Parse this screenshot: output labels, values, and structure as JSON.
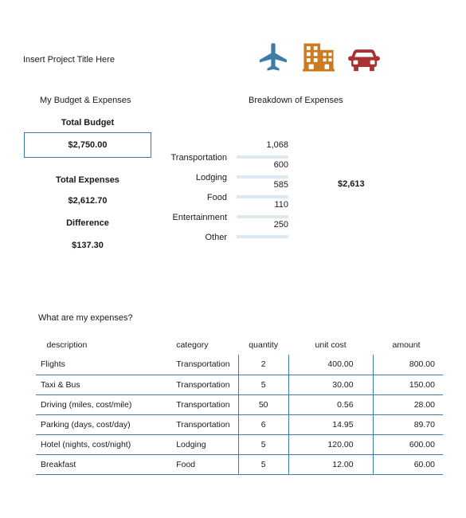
{
  "project_title": "Insert Project Title Here",
  "icons": [
    {
      "name": "airplane-icon",
      "color": "#3d7ba8"
    },
    {
      "name": "building-icon",
      "color": "#cc7a1f"
    },
    {
      "name": "car-icon",
      "color": "#a93232"
    }
  ],
  "budget_section": {
    "heading": "My Budget & Expenses",
    "total_budget_label": "Total Budget",
    "total_budget_value": "$2,750.00",
    "total_expenses_label": "Total Expenses",
    "total_expenses_value": "$2,612.70",
    "difference_label": "Difference",
    "difference_value": "$137.30"
  },
  "breakdown_section": {
    "heading": "Breakdown of Expenses",
    "total": "$2,613",
    "rows": [
      {
        "name": "Transportation",
        "value": "1,068"
      },
      {
        "name": "Lodging",
        "value": "600"
      },
      {
        "name": "Food",
        "value": "585"
      },
      {
        "name": "Entertainment",
        "value": "110"
      },
      {
        "name": "Other",
        "value": "250"
      }
    ]
  },
  "expenses_section": {
    "question": "What are my expenses?",
    "columns": [
      "description",
      "category",
      "quantity",
      "unit cost",
      "amount"
    ],
    "rows": [
      {
        "description": "Flights",
        "category": "Transportation",
        "quantity": "2",
        "unit_cost": "400.00",
        "amount": "800.00"
      },
      {
        "description": "Taxi & Bus",
        "category": "Transportation",
        "quantity": "5",
        "unit_cost": "30.00",
        "amount": "150.00"
      },
      {
        "description": "Driving (miles, cost/mile)",
        "category": "Transportation",
        "quantity": "50",
        "unit_cost": "0.56",
        "amount": "28.00"
      },
      {
        "description": "Parking (days, cost/day)",
        "category": "Transportation",
        "quantity": "6",
        "unit_cost": "14.95",
        "amount": "89.70"
      },
      {
        "description": "Hotel (nights, cost/night)",
        "category": "Lodging",
        "quantity": "5",
        "unit_cost": "120.00",
        "amount": "600.00"
      },
      {
        "description": "Breakfast",
        "category": "Food",
        "quantity": "5",
        "unit_cost": "12.00",
        "amount": "60.00"
      }
    ]
  },
  "colors": {
    "accent_blue": "#3d7ba8",
    "rule_blue": "#dde8f1",
    "icon_orange": "#cc7a1f",
    "icon_red": "#a93232"
  }
}
